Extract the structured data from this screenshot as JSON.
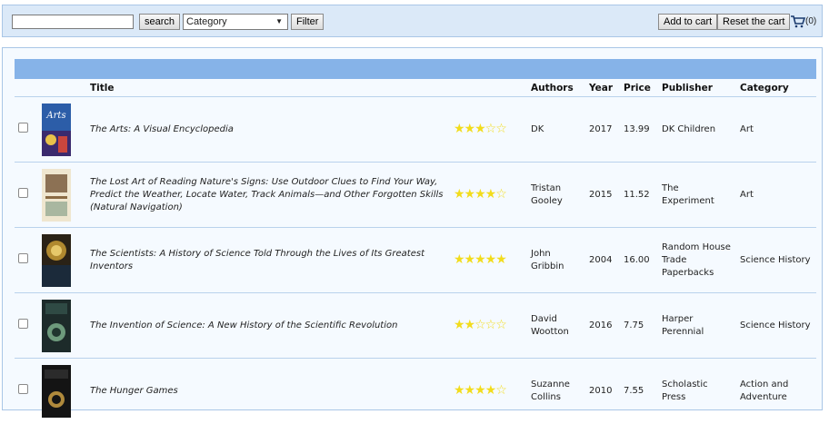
{
  "toolbar": {
    "search_value": "",
    "search_button": "search",
    "category_selected": "Category",
    "filter_button": "Filter",
    "add_to_cart": "Add to cart",
    "reset_cart": "Reset the cart",
    "cart_count": "(0)"
  },
  "table": {
    "headers": {
      "title": "Title",
      "authors": "Authors",
      "year": "Year",
      "price": "Price",
      "publisher": "Publisher",
      "category": "Category"
    },
    "rows": [
      {
        "title": "The Arts: A Visual Encyclopedia",
        "rating": 3,
        "authors": "DK",
        "year": "2017",
        "price": "13.99",
        "publisher": "DK Children",
        "category": "Art"
      },
      {
        "title": "The Lost Art of Reading Nature's Signs: Use Outdoor Clues to Find Your Way, Predict the Weather, Locate Water, Track Animals—and Other Forgotten Skills (Natural Navigation)",
        "rating": 4,
        "authors": "Tristan Gooley",
        "year": "2015",
        "price": "11.52",
        "publisher": "The Experiment",
        "category": "Art"
      },
      {
        "title": "The Scientists: A History of Science Told Through the Lives of Its Greatest Inventors",
        "rating": 5,
        "authors": "John Gribbin",
        "year": "2004",
        "price": "16.00",
        "publisher": "Random House Trade Paperbacks",
        "category": "Science History"
      },
      {
        "title": "The Invention of Science: A New History of the Scientific Revolution",
        "rating": 2,
        "authors": "David Wootton",
        "year": "2016",
        "price": "7.75",
        "publisher": "Harper Perennial",
        "category": "Science History"
      },
      {
        "title": "The Hunger Games",
        "rating": 4,
        "authors": "Suzanne Collins",
        "year": "2010",
        "price": "7.55",
        "publisher": "Scholastic Press",
        "category": "Action and Adventure"
      }
    ]
  },
  "colors": {
    "toolbar_bg": "#dbe9f8",
    "band": "#86b3e8",
    "star": "#f2dc1c"
  }
}
